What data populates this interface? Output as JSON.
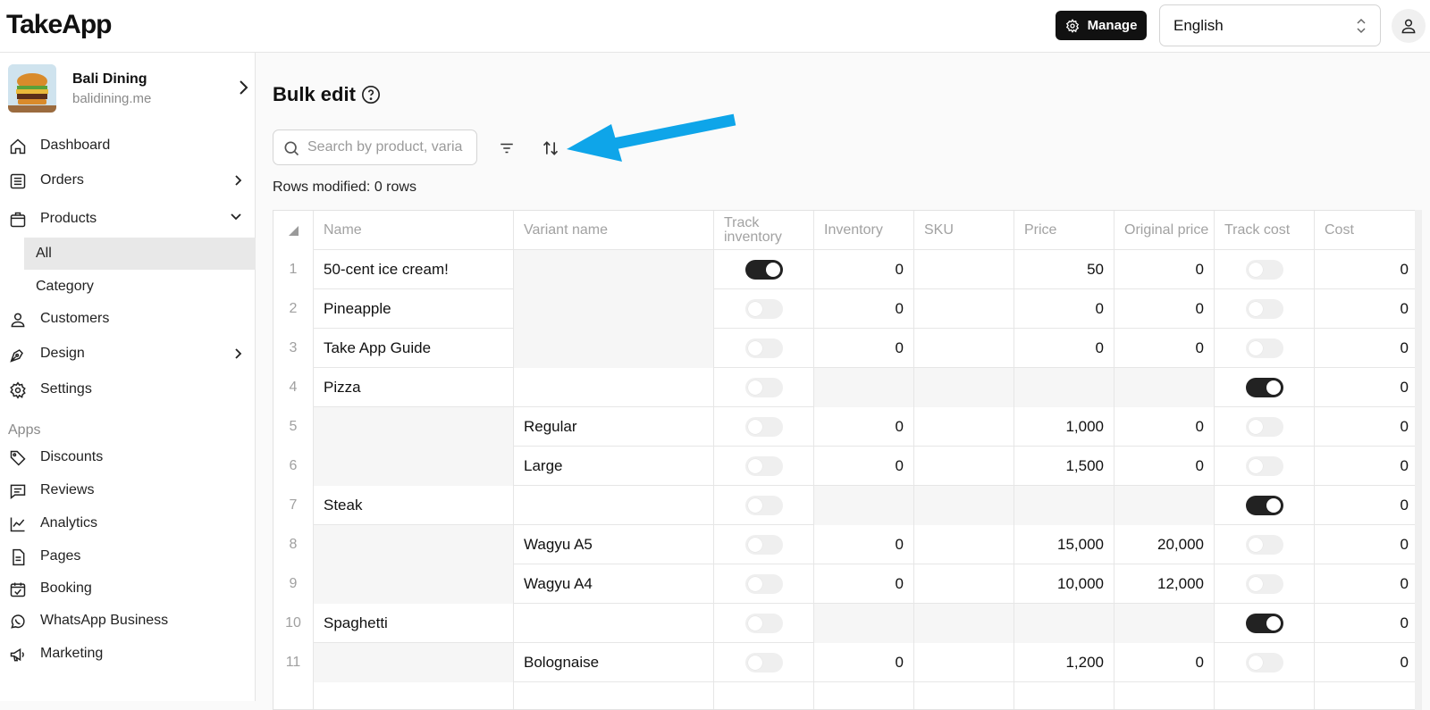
{
  "app": {
    "logo": "TakeApp"
  },
  "header": {
    "manage_label": "Manage",
    "language": "English"
  },
  "store": {
    "name": "Bali Dining",
    "url": "balidining.me"
  },
  "sidebar": {
    "dashboard": "Dashboard",
    "orders": "Orders",
    "products": "Products",
    "products_all": "All",
    "products_category": "Category",
    "customers": "Customers",
    "design": "Design",
    "settings": "Settings",
    "apps_label": "Apps",
    "discounts": "Discounts",
    "reviews": "Reviews",
    "analytics": "Analytics",
    "pages": "Pages",
    "booking": "Booking",
    "whatsapp": "WhatsApp Business",
    "marketing": "Marketing"
  },
  "main": {
    "title": "Bulk edit",
    "search_placeholder": "Search by product, varia",
    "rows_modified": "Rows modified: 0 rows"
  },
  "table": {
    "headers": {
      "name": "Name",
      "variant": "Variant name",
      "track_inventory": "Track inventory",
      "inventory": "Inventory",
      "sku": "SKU",
      "price": "Price",
      "original_price": "Original price",
      "track_cost": "Track cost",
      "cost": "Cost"
    },
    "rows": [
      {
        "idx": "1",
        "name": "50-cent ice cream!",
        "variant": "",
        "track_inv": true,
        "inventory": "0",
        "sku": "",
        "price": "50",
        "orig": "0",
        "track_cost": false,
        "cost": "0",
        "parent": false
      },
      {
        "idx": "2",
        "name": "Pineapple",
        "variant": "",
        "track_inv": false,
        "inventory": "0",
        "sku": "",
        "price": "0",
        "orig": "0",
        "track_cost": false,
        "cost": "0",
        "parent": false
      },
      {
        "idx": "3",
        "name": "Take App Guide",
        "variant": "",
        "track_inv": false,
        "inventory": "0",
        "sku": "",
        "price": "0",
        "orig": "0",
        "track_cost": false,
        "cost": "0",
        "parent": false
      },
      {
        "idx": "4",
        "name": "Pizza",
        "variant": "",
        "track_inv": false,
        "inventory": "",
        "sku": "",
        "price": "",
        "orig": "",
        "track_cost": true,
        "cost": "0",
        "parent": true
      },
      {
        "idx": "5",
        "name": "",
        "variant": "Regular",
        "track_inv": false,
        "inventory": "0",
        "sku": "",
        "price": "1,000",
        "orig": "0",
        "track_cost": false,
        "cost": "0",
        "parent": false,
        "child": true
      },
      {
        "idx": "6",
        "name": "",
        "variant": "Large",
        "track_inv": false,
        "inventory": "0",
        "sku": "",
        "price": "1,500",
        "orig": "0",
        "track_cost": false,
        "cost": "0",
        "parent": false,
        "child": true
      },
      {
        "idx": "7",
        "name": "Steak",
        "variant": "",
        "track_inv": false,
        "inventory": "",
        "sku": "",
        "price": "",
        "orig": "",
        "track_cost": true,
        "cost": "0",
        "parent": true
      },
      {
        "idx": "8",
        "name": "",
        "variant": "Wagyu A5",
        "track_inv": false,
        "inventory": "0",
        "sku": "",
        "price": "15,000",
        "orig": "20,000",
        "track_cost": false,
        "cost": "0",
        "parent": false,
        "child": true
      },
      {
        "idx": "9",
        "name": "",
        "variant": "Wagyu A4",
        "track_inv": false,
        "inventory": "0",
        "sku": "",
        "price": "10,000",
        "orig": "12,000",
        "track_cost": false,
        "cost": "0",
        "parent": false,
        "child": true
      },
      {
        "idx": "10",
        "name": "Spaghetti",
        "variant": "",
        "track_inv": false,
        "inventory": "",
        "sku": "",
        "price": "",
        "orig": "",
        "track_cost": true,
        "cost": "0",
        "parent": true
      },
      {
        "idx": "11",
        "name": "",
        "variant": "Bolognaise",
        "track_inv": false,
        "inventory": "0",
        "sku": "",
        "price": "1,200",
        "orig": "0",
        "track_cost": false,
        "cost": "0",
        "parent": false,
        "child": true
      },
      {
        "idx": "",
        "name": "",
        "variant": "",
        "track_inv": false,
        "inventory": "",
        "sku": "",
        "price": "",
        "orig": "",
        "track_cost": false,
        "cost": "",
        "parent": false,
        "partial": true
      }
    ]
  },
  "colors": {
    "accent_arrow": "#0ea5e9",
    "toggle_on": "#222222",
    "manage_bg": "#111111"
  }
}
